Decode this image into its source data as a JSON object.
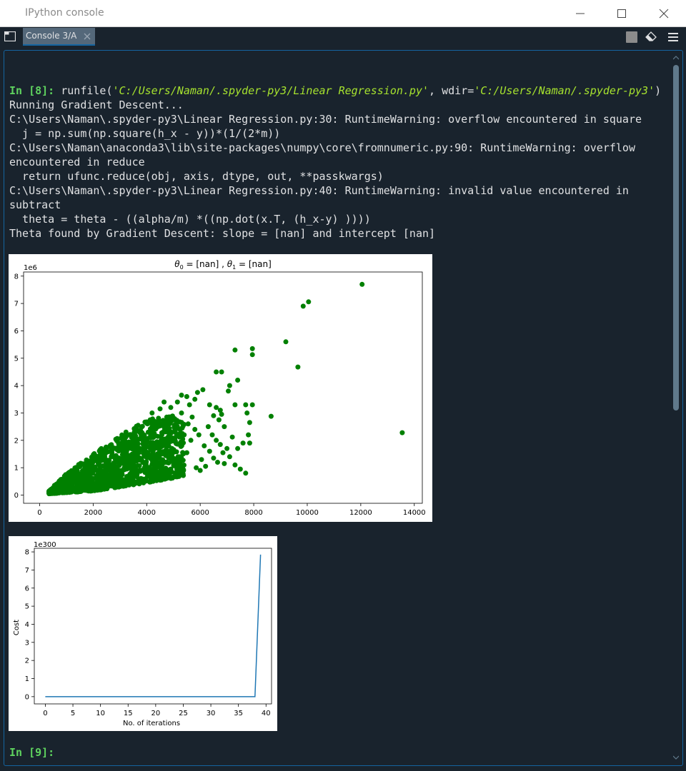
{
  "window": {
    "title": "IPython console"
  },
  "tabs": [
    {
      "label": "Console 3/A"
    }
  ],
  "console": {
    "prompt_in8": "In [8]: ",
    "cmd_runfile": "runfile(",
    "cmd_path": "'C:/Users/Naman/.spyder-py3/Linear Regression.py'",
    "cmd_wdir": ", wdir=",
    "cmd_wdir_val": "'C:/Users/Naman/.spyder-py3'",
    "cmd_end": ")",
    "output_lines": [
      "Running Gradient Descent...",
      "C:\\Users\\Naman\\.spyder-py3\\Linear Regression.py:30: RuntimeWarning: overflow encountered in square",
      "  j = np.sum(np.square(h_x - y))*(1/(2*m))",
      "C:\\Users\\Naman\\anaconda3\\lib\\site-packages\\numpy\\core\\fromnumeric.py:90: RuntimeWarning: overflow",
      "encountered in reduce",
      "  return ufunc.reduce(obj, axis, dtype, out, **passkwargs)",
      "C:\\Users\\Naman\\.spyder-py3\\Linear Regression.py:40: RuntimeWarning: invalid value encountered in",
      "subtract",
      "  theta = theta - ((alpha/m) *((np.dot(x.T, (h_x-y) ))))",
      "Theta found by Gradient Descent: slope = [nan] and intercept [nan]"
    ],
    "prompt_in9": "In [9]:"
  },
  "colors": {
    "background": "#19232d",
    "prompt": "#5fd35f",
    "text": "#e0e1e3",
    "string": "#a6e22e",
    "scatter": "#008000",
    "line": "#1f77b4"
  },
  "chart_data": [
    {
      "type": "scatter",
      "title_parts": [
        "θ",
        "0",
        " = [nan] , ",
        "θ",
        "1",
        " = [nan]"
      ],
      "xlabel": "",
      "ylabel": "",
      "y_offset_text": "1e6",
      "xlim": [
        -600,
        14300
      ],
      "ylim": [
        -0.3,
        8.15
      ],
      "xticks": [
        0,
        2000,
        4000,
        6000,
        8000,
        10000,
        12000,
        14000
      ],
      "yticks": [
        0,
        1,
        2,
        3,
        4,
        5,
        6,
        7,
        8
      ],
      "marker_color": "#008000",
      "points": [
        [
          12050,
          7.7
        ],
        [
          10050,
          7.06
        ],
        [
          9850,
          6.9
        ],
        [
          9200,
          5.6
        ],
        [
          9650,
          4.68
        ],
        [
          7950,
          5.35
        ],
        [
          7950,
          5.13
        ],
        [
          7300,
          5.3
        ],
        [
          6600,
          4.5
        ],
        [
          6800,
          4.5
        ],
        [
          7400,
          4.2
        ],
        [
          7100,
          4.0
        ],
        [
          7050,
          3.8
        ],
        [
          7300,
          3.3
        ],
        [
          7700,
          3.3
        ],
        [
          7950,
          3.3
        ],
        [
          7750,
          3.0
        ],
        [
          7850,
          2.65
        ],
        [
          7800,
          2.2
        ],
        [
          8650,
          2.88
        ],
        [
          13550,
          2.28
        ],
        [
          7200,
          2.12
        ],
        [
          7400,
          1.7
        ],
        [
          7600,
          1.9
        ],
        [
          7850,
          1.9
        ],
        [
          7000,
          1.7
        ],
        [
          7100,
          1.4
        ],
        [
          7300,
          1.1
        ],
        [
          7500,
          0.95
        ],
        [
          7700,
          0.8
        ],
        [
          6100,
          3.85
        ],
        [
          5900,
          3.75
        ],
        [
          5800,
          3.5
        ],
        [
          6350,
          3.3
        ],
        [
          6600,
          3.2
        ],
        [
          6750,
          3.1
        ],
        [
          6500,
          2.9
        ],
        [
          6800,
          2.95
        ],
        [
          6700,
          2.75
        ],
        [
          6900,
          2.5
        ],
        [
          6300,
          2.5
        ],
        [
          6450,
          2.2
        ],
        [
          6600,
          2.0
        ],
        [
          6750,
          1.85
        ],
        [
          6850,
          1.55
        ],
        [
          6150,
          1.8
        ],
        [
          6350,
          1.6
        ],
        [
          6500,
          1.35
        ],
        [
          6650,
          1.2
        ],
        [
          6900,
          1.15
        ],
        [
          6050,
          1.3
        ],
        [
          6200,
          1.05
        ],
        [
          5850,
          1.0
        ],
        [
          6000,
          0.9
        ],
        [
          5300,
          3.65
        ],
        [
          5500,
          3.6
        ],
        [
          5600,
          3.3
        ],
        [
          5150,
          3.4
        ],
        [
          5300,
          3.0
        ],
        [
          5700,
          2.85
        ],
        [
          5550,
          2.6
        ],
        [
          5800,
          2.4
        ],
        [
          5950,
          2.2
        ],
        [
          5650,
          2.0
        ],
        [
          5400,
          2.2
        ],
        [
          4650,
          3.4
        ],
        [
          4900,
          3.2
        ],
        [
          4500,
          3.15
        ],
        [
          4750,
          2.85
        ],
        [
          5100,
          2.7
        ],
        [
          4450,
          2.75
        ],
        [
          4200,
          3.0
        ],
        [
          5200,
          1.2
        ],
        [
          5500,
          1.55
        ],
        [
          4900,
          0.95
        ],
        [
          5100,
          0.8
        ],
        [
          4700,
          0.7
        ],
        [
          4850,
          1.6
        ]
      ],
      "cloud": {
        "x_range": [
          350,
          5400
        ],
        "y_at_x": [
          [
            350,
            0.15
          ],
          [
            1000,
            0.8
          ],
          [
            2000,
            1.5
          ],
          [
            3000,
            2.2
          ],
          [
            4000,
            2.8
          ],
          [
            5000,
            2.9
          ],
          [
            5400,
            2.6
          ]
        ],
        "baseline_at_x": [
          [
            350,
            0.05
          ],
          [
            2000,
            0.15
          ],
          [
            4000,
            0.45
          ],
          [
            5400,
            0.7
          ]
        ]
      }
    },
    {
      "type": "line",
      "xlabel": "No. of iterations",
      "ylabel": "Cost",
      "y_offset_text": "1e300",
      "xlim": [
        -2,
        41
      ],
      "ylim": [
        -0.4,
        8.2
      ],
      "xticks": [
        0,
        5,
        10,
        15,
        20,
        25,
        30,
        35,
        40
      ],
      "yticks": [
        0,
        1,
        2,
        3,
        4,
        5,
        6,
        7,
        8
      ],
      "line_color": "#1f77b4",
      "x": [
        0,
        1,
        2,
        3,
        4,
        5,
        6,
        7,
        8,
        9,
        10,
        11,
        12,
        13,
        14,
        15,
        16,
        17,
        18,
        19,
        20,
        21,
        22,
        23,
        24,
        25,
        26,
        27,
        28,
        29,
        30,
        31,
        32,
        33,
        34,
        35,
        36,
        37,
        38,
        39
      ],
      "y": [
        0,
        0,
        0,
        0,
        0,
        0,
        0,
        0,
        0,
        0,
        0,
        0,
        0,
        0,
        0,
        0,
        0,
        0,
        0,
        0,
        0,
        0,
        0,
        0,
        0,
        0,
        0,
        0,
        0,
        0,
        0,
        0,
        0,
        0,
        0,
        0,
        0,
        0,
        0,
        7.85
      ]
    }
  ]
}
